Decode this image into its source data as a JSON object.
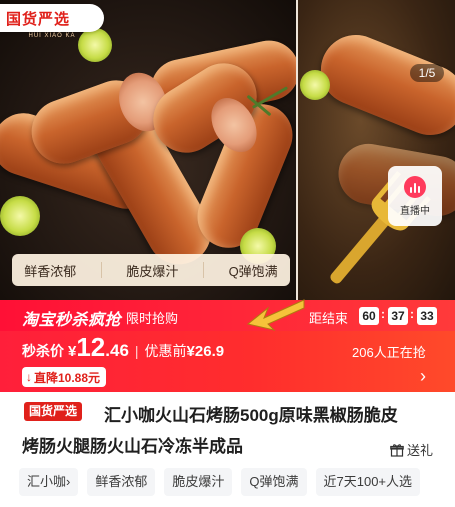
{
  "gallery": {
    "logo_text": "国货严选",
    "logo_sub": "HUI XIAO KA",
    "chips": [
      "鲜香浓郁",
      "脆皮爆汁",
      "Q弹饱满"
    ],
    "page_counter": "1/5",
    "live_label": "直播中"
  },
  "flash_sale": {
    "brand": "淘宝秒杀疯抢",
    "tag": "限时抢购",
    "countdown_label": "距结束",
    "countdown": [
      "60",
      "37",
      "33"
    ],
    "price_label": "秒杀价",
    "currency": "¥",
    "price_int": "12",
    "price_dec": ".46",
    "separator": "|",
    "before_label": "优惠前",
    "before_value": "¥26.9",
    "watchers": "206人正在抢",
    "drop_text": "直降10.88元"
  },
  "product": {
    "badge": "国货严选",
    "title_line1": "汇小咖火山石烤肠500g原味黑椒肠脆皮",
    "title_line2": "烤肠火腿肠火山石冷冻半成品",
    "gift_label": "送礼"
  },
  "tags": [
    "汇小咖›",
    "鲜香浓郁",
    "脆皮爆汁",
    "Q弹饱满",
    "近7天100+人选"
  ],
  "colors": {
    "accent": "#e0211b",
    "flash_bg": "#ff2d2d",
    "live_pink": "#ff3b5c"
  }
}
